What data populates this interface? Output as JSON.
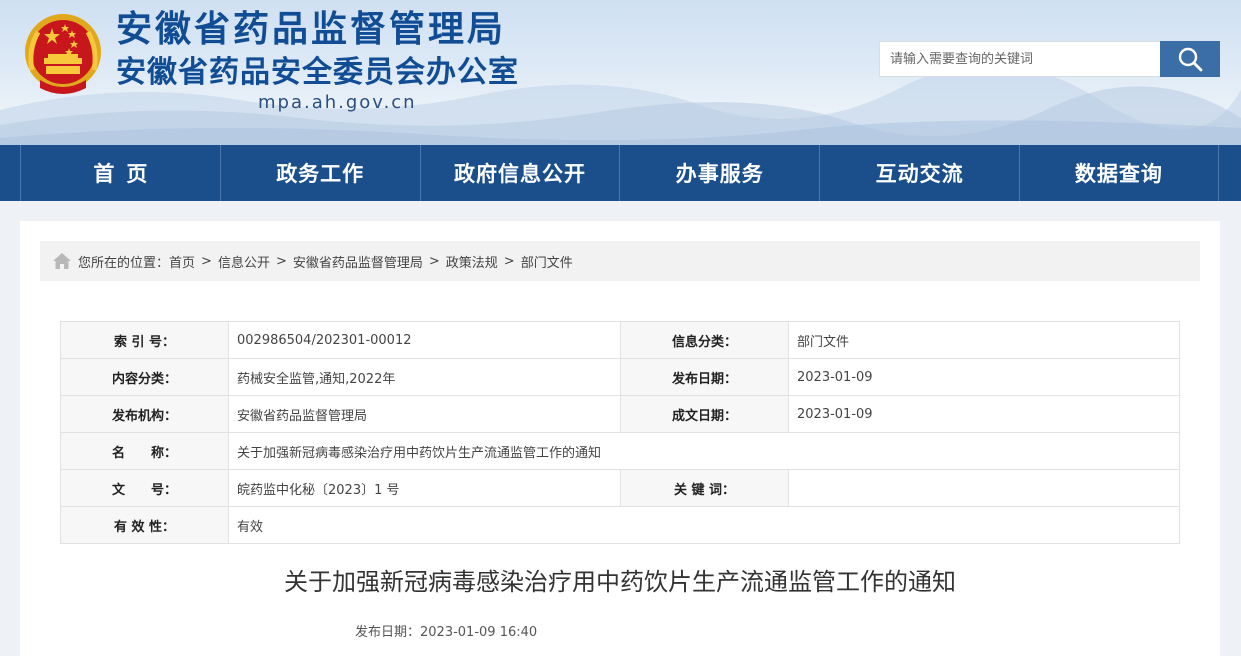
{
  "header": {
    "title_main": "安徽省药品监督管理局",
    "title_sub": "安徽省药品安全委员会办公室",
    "domain": "mpa.ah.gov.cn",
    "search_placeholder": "请输入需要查询的关键词",
    "search_icon": "search-icon",
    "brand_color": "#114d95"
  },
  "nav": {
    "bg_color": "#1a4f8c",
    "items": [
      {
        "label": "首页"
      },
      {
        "label": "政务工作"
      },
      {
        "label": "政府信息公开"
      },
      {
        "label": "办事服务"
      },
      {
        "label": "互动交流"
      },
      {
        "label": "数据查询"
      }
    ]
  },
  "breadcrumb": {
    "icon": "home-icon",
    "prefix": "您所在的位置：",
    "items": [
      "首页",
      "信息公开",
      "安徽省药品监督管理局",
      "政策法规",
      "部门文件"
    ],
    "separator": ">"
  },
  "meta": {
    "index_label": "索 引 号：",
    "index_value": "002986504/202301-00012",
    "category_label": "信息分类：",
    "category_value": "部门文件",
    "content_label": "内容分类：",
    "content_value": "药械安全监管,通知,2022年",
    "publish_label": "发布日期：",
    "publish_value": "2023-01-09",
    "org_label": "发布机构：",
    "org_value": "安徽省药品监督管理局",
    "created_label": "成文日期：",
    "created_value": "2023-01-09",
    "name_label": "名　　称：",
    "name_value": "关于加强新冠病毒感染治疗用中药饮片生产流通监管工作的通知",
    "docno_label": "文　　号：",
    "docno_value": "皖药监中化秘〔2023〕1 号",
    "keyword_label": "关 键 词：",
    "keyword_value": "",
    "validity_label": "有 效 性：",
    "validity_value": "有效"
  },
  "article": {
    "title": "关于加强新冠病毒感染治疗用中药饮片生产流通监管工作的通知",
    "date_label": "发布日期：",
    "date_value": "2023-01-09 16:40"
  }
}
